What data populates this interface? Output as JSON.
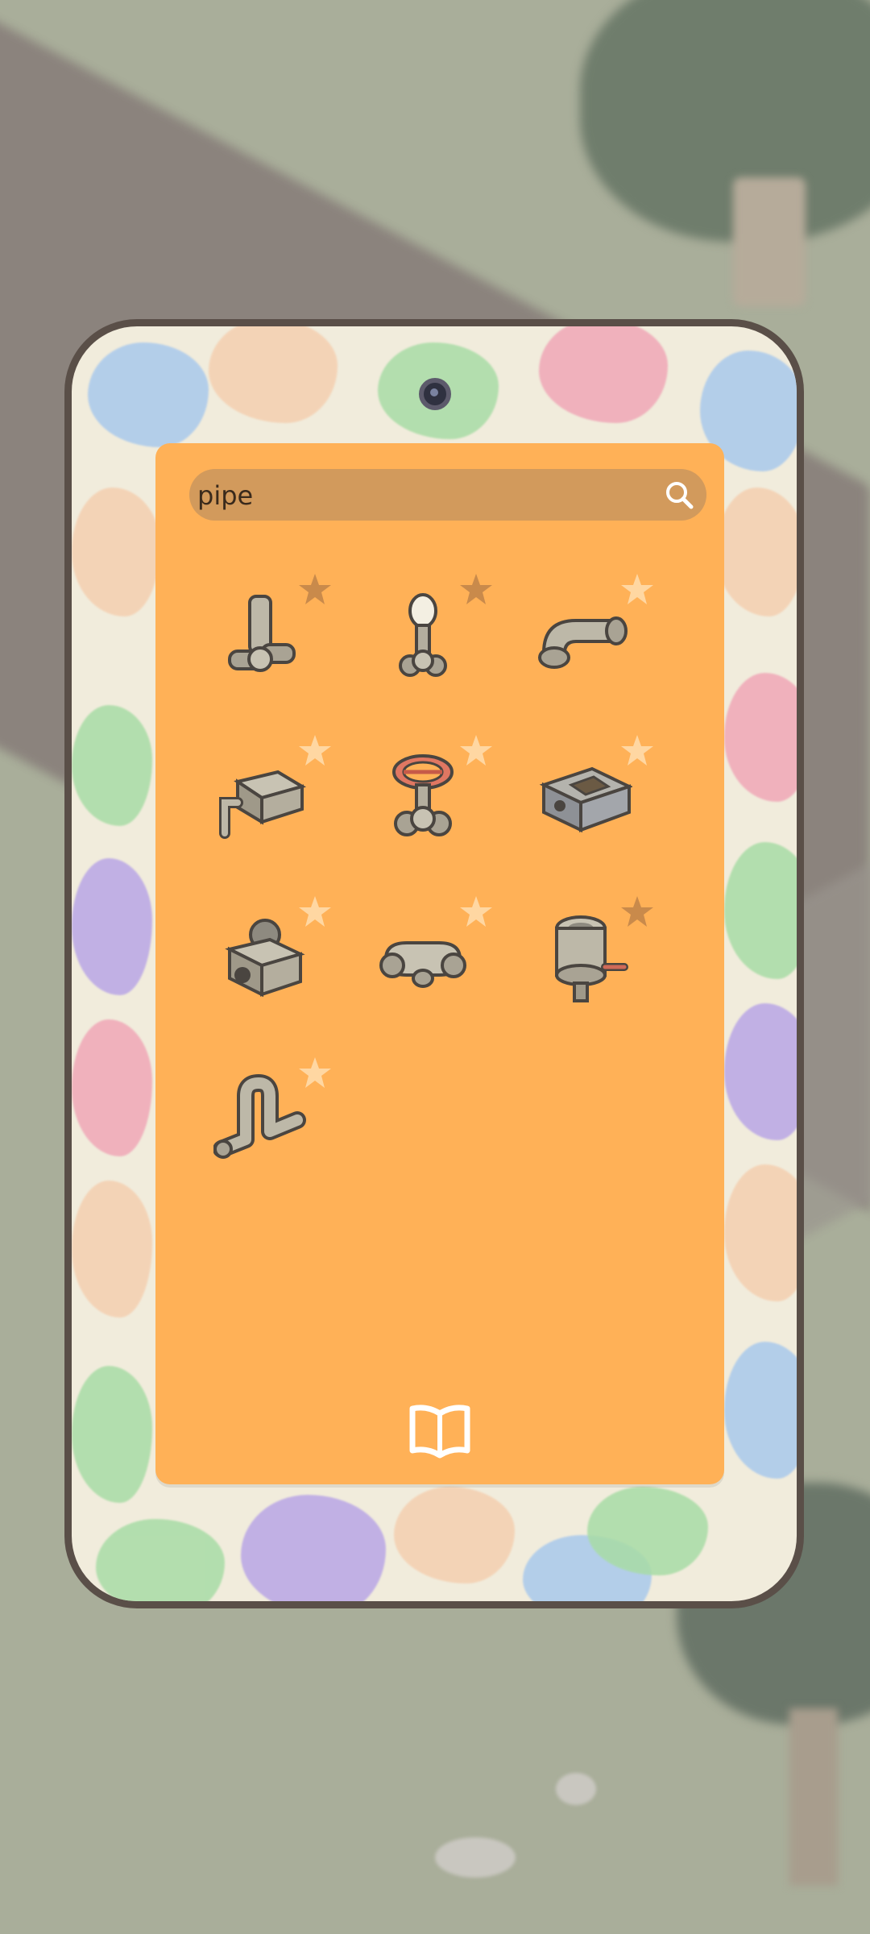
{
  "search": {
    "value": "pipe",
    "placeholder": ""
  },
  "items": [
    {
      "icon": "pipe-tee-icon",
      "favorite": false
    },
    {
      "icon": "pipe-lamp-icon",
      "favorite": false
    },
    {
      "icon": "pipe-elbow-icon",
      "favorite": true
    },
    {
      "icon": "pipe-junction-box-icon",
      "favorite": true
    },
    {
      "icon": "pipe-valve-wheel-icon",
      "favorite": true
    },
    {
      "icon": "pipe-box-window-icon",
      "favorite": true
    },
    {
      "icon": "pipe-gear-box-icon",
      "favorite": true
    },
    {
      "icon": "pipe-cross-icon",
      "favorite": true
    },
    {
      "icon": "pipe-tank-icon",
      "favorite": false
    },
    {
      "icon": "pipe-s-bend-icon",
      "favorite": true
    }
  ],
  "colors": {
    "panel": "#ffb157",
    "search_bg": "#d29a5c",
    "star_favorite": "#ffd7a2",
    "star_normal": "#c98a4b",
    "phone_frame": "#5a4f48"
  }
}
